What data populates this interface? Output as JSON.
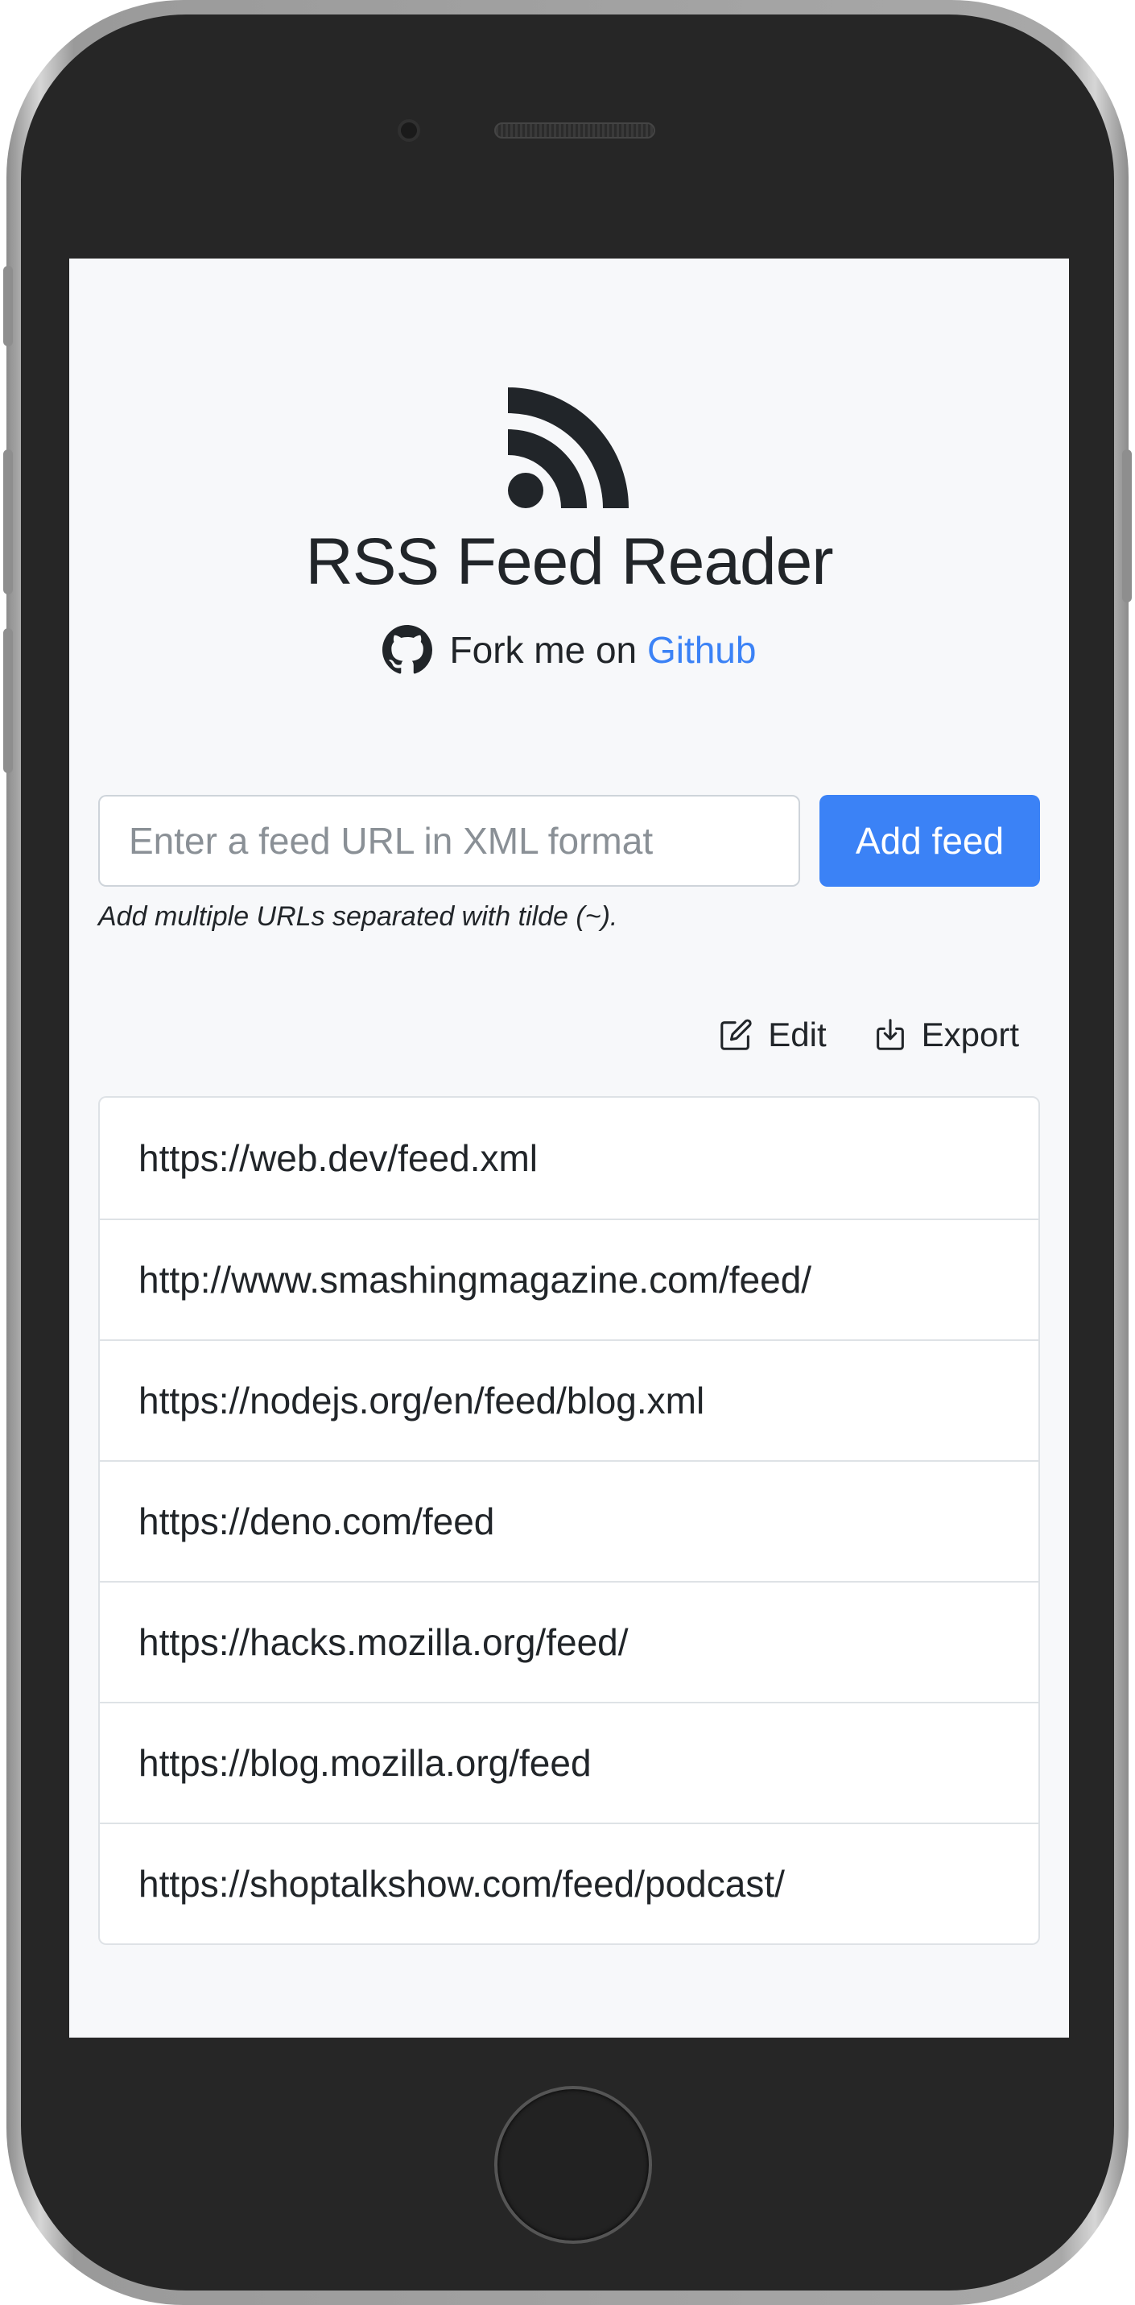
{
  "app": {
    "title": "RSS Feed Reader"
  },
  "fork": {
    "text": "Fork me on",
    "link_label": "Github"
  },
  "add_feed": {
    "placeholder": "Enter a feed URL in XML format",
    "value": "",
    "button_label": "Add feed",
    "help_text": "Add multiple URLs separated with tilde (~)."
  },
  "toolbar": {
    "edit_label": "Edit",
    "export_label": "Export"
  },
  "feeds": [
    "https://web.dev/feed.xml",
    "http://www.smashingmagazine.com/feed/",
    "https://nodejs.org/en/feed/blog.xml",
    "https://deno.com/feed",
    "https://hacks.mozilla.org/feed/",
    "https://blog.mozilla.org/feed",
    "https://shoptalkshow.com/feed/podcast/"
  ],
  "icons": {
    "logo": "rss-icon",
    "fork": "github-icon",
    "edit": "edit-icon",
    "export": "download-icon"
  },
  "colors": {
    "accent": "#3b82f6",
    "screen_background": "#f7f8fa",
    "text": "#212529",
    "border": "#dee2e6",
    "phone_body": "#262626"
  }
}
